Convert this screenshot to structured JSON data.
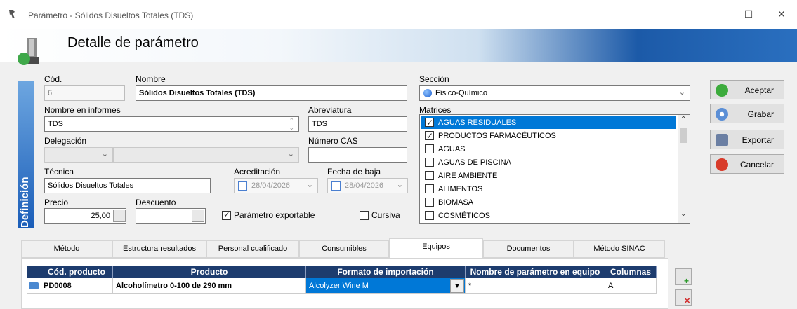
{
  "window": {
    "title": "Parámetro - Sólidos Disueltos Totales (TDS)",
    "minimize": "—",
    "maximize": "☐",
    "close": "✕"
  },
  "header": {
    "title": "Detalle de parámetro"
  },
  "side_tab": {
    "label": "Definición"
  },
  "fields": {
    "cod_label": "Cód.",
    "cod_value": "6",
    "nombre_label": "Nombre",
    "nombre_value": "Sólidos Disueltos Totales (TDS)",
    "nombre_informes_label": "Nombre en informes",
    "nombre_informes_value": "TDS",
    "abreviatura_label": "Abreviatura",
    "abreviatura_value": "TDS",
    "delegacion_label": "Delegación",
    "numero_cas_label": "Número CAS",
    "numero_cas_value": "",
    "tecnica_label": "Técnica",
    "tecnica_value": "Sólidos Disueltos Totales",
    "acreditacion_label": "Acreditación",
    "acreditacion_value": "28/04/2026",
    "fecha_baja_label": "Fecha de baja",
    "fecha_baja_value": "28/04/2026",
    "precio_label": "Precio",
    "precio_value": "25,00",
    "descuento_label": "Descuento",
    "descuento_value": "",
    "exportable_label": "Parámetro exportable",
    "cursiva_label": "Cursiva",
    "seccion_label": "Sección",
    "seccion_value": "Físico-Químico",
    "matrices_label": "Matrices"
  },
  "matrices": [
    {
      "label": "AGUAS RESIDUALES",
      "checked": true,
      "selected": true
    },
    {
      "label": "PRODUCTOS FARMACÉUTICOS",
      "checked": true,
      "selected": false
    },
    {
      "label": "AGUAS",
      "checked": false,
      "selected": false
    },
    {
      "label": "AGUAS DE PISCINA",
      "checked": false,
      "selected": false
    },
    {
      "label": "AIRE AMBIENTE",
      "checked": false,
      "selected": false
    },
    {
      "label": "ALIMENTOS",
      "checked": false,
      "selected": false
    },
    {
      "label": "BIOMASA",
      "checked": false,
      "selected": false
    },
    {
      "label": "COSMÉTICOS",
      "checked": false,
      "selected": false
    }
  ],
  "actions": {
    "aceptar": "Aceptar",
    "grabar": "Grabar",
    "exportar": "Exportar",
    "cancelar": "Cancelar"
  },
  "tabs": [
    "Método",
    "Estructura resultados",
    "Personal cualificado",
    "Consumibles",
    "Equipos",
    "Documentos",
    "Método SINAC"
  ],
  "grid": {
    "headers": [
      "Cód. producto",
      "Producto",
      "Formato de importación",
      "Nombre de parámetro en equipo",
      "Columnas"
    ],
    "row": {
      "codigo": "PD0008",
      "producto": "Alcoholímetro 0-100 de 290 mm",
      "formato": "Alcolyzer Wine M",
      "nombre_param": "*",
      "columnas": "A"
    }
  },
  "colors": {
    "accent": "#0078d7",
    "grid_header": "#1d3c6e"
  }
}
